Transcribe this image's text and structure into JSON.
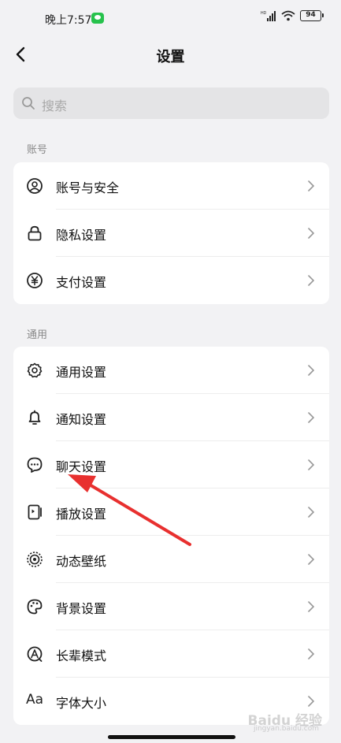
{
  "status_bar": {
    "time": "晚上7:57",
    "battery": "94",
    "network_label": "HD"
  },
  "nav": {
    "title": "设置"
  },
  "search": {
    "placeholder": "搜索"
  },
  "sections": [
    {
      "label": "账号",
      "items": [
        {
          "label": "账号与安全",
          "icon": "user-circle-icon"
        },
        {
          "label": "隐私设置",
          "icon": "lock-icon"
        },
        {
          "label": "支付设置",
          "icon": "yen-icon"
        }
      ]
    },
    {
      "label": "通用",
      "items": [
        {
          "label": "通用设置",
          "icon": "gear-icon"
        },
        {
          "label": "通知设置",
          "icon": "bell-icon"
        },
        {
          "label": "聊天设置",
          "icon": "chat-bubble-icon"
        },
        {
          "label": "播放设置",
          "icon": "play-device-icon"
        },
        {
          "label": "动态壁纸",
          "icon": "live-wallpaper-icon"
        },
        {
          "label": "背景设置",
          "icon": "palette-icon"
        },
        {
          "label": "长辈模式",
          "icon": "elder-mode-icon"
        },
        {
          "label": "字体大小",
          "icon": "font-size-icon",
          "glyph": "Aa"
        }
      ]
    }
  ],
  "annotation": {
    "color": "#e8302f",
    "target": "聊天设置"
  },
  "watermark": {
    "text": "Baidu 经验",
    "sub": "jingyan.baidu.com"
  }
}
